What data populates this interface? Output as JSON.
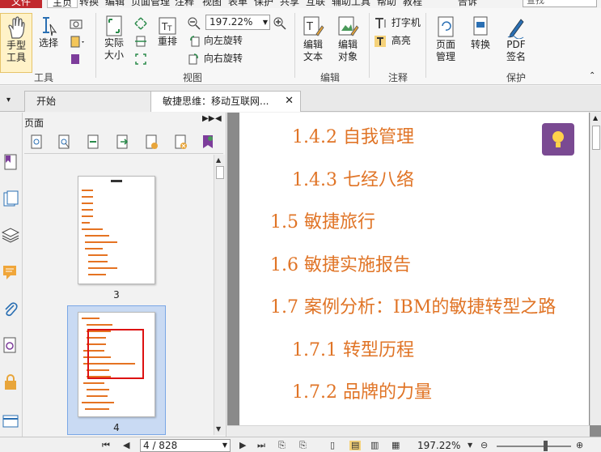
{
  "menu": {
    "items": [
      "文件",
      "主页",
      "转换",
      "编辑",
      "页面管理",
      "注释",
      "视图",
      "表单",
      "保护",
      "共享",
      "互联",
      "辅助工具",
      "帮助",
      "教程",
      "告诉",
      "查找"
    ],
    "search_placeholder": "查找"
  },
  "ribbon": {
    "hand_tool": "手型\n工具",
    "hand_tool_l1": "手型",
    "hand_tool_l2": "工具",
    "select_l1": "选择",
    "actual_size_l1": "实际",
    "actual_size_l2": "大小",
    "reflow": "重排",
    "zoom_value": "197.22%",
    "rotate_left": "向左旋转",
    "rotate_right": "向右旋转",
    "edit_text_l1": "编辑",
    "edit_text_l2": "文本",
    "edit_object_l1": "编辑",
    "edit_object_l2": "对象",
    "typewriter": "打字机",
    "highlight": "高亮",
    "page_mgmt_l1": "页面",
    "page_mgmt_l2": "管理",
    "convert": "转换",
    "pdf_sign_l1": "PDF",
    "pdf_sign_l2": "签名",
    "groups": {
      "tools": "工具",
      "view": "视图",
      "edit": "编辑",
      "annotate": "注释",
      "protect": "保护"
    }
  },
  "tabs": [
    {
      "label": "开始"
    },
    {
      "label": "敏捷思维：移动互联网..."
    }
  ],
  "panel": {
    "title": "页面",
    "thumbnails": [
      {
        "page_label": "3"
      },
      {
        "page_label": "4"
      }
    ]
  },
  "document": {
    "toc": [
      "1.4.2 自我管理",
      "1.4.3 七经八络",
      "1.5 敏捷旅行",
      "1.6 敏捷实施报告",
      "1.7 案例分析：IBM的敏捷转型之路",
      "1.7.1 转型历程",
      "1.7.2 品牌的力量"
    ]
  },
  "status": {
    "page_indicator": "4 / 828",
    "zoom": "197.22%"
  },
  "colors": {
    "file_menu": "#c1292e",
    "toc_text": "#e07426",
    "lamp_bg": "#7a4a92",
    "selection": "#c9daf3"
  }
}
